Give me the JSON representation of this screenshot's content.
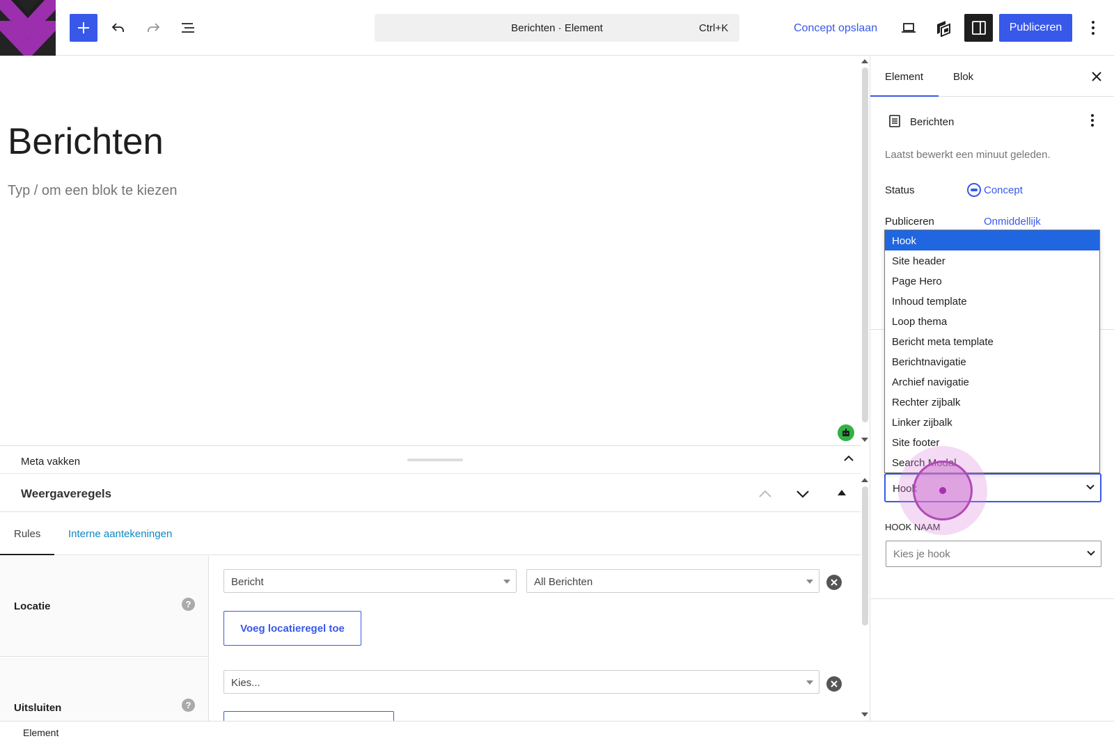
{
  "topbar": {
    "command_title": "Berichten · Element",
    "command_shortcut": "Ctrl+K",
    "save_draft_label": "Concept opslaan",
    "publish_label": "Publiceren"
  },
  "canvas": {
    "title": "Berichten",
    "placeholder": "Typ / om een blok te kiezen"
  },
  "meta_boxes": {
    "label": "Meta vakken",
    "panel_title": "Weergaveregels",
    "tabs": [
      "Rules",
      "Interne aantekeningen"
    ],
    "location": {
      "label": "Locatie",
      "help": "?",
      "rule_type": "Bericht",
      "rule_value": "All Berichten",
      "add_button": "Voeg locatieregel toe"
    },
    "exclude": {
      "label": "Uitsluiten",
      "help": "?",
      "select_value": "Kies..."
    }
  },
  "footer": {
    "breadcrumb": "Element"
  },
  "sidebar": {
    "tabs": [
      "Element",
      "Blok"
    ],
    "document_name": "Berichten",
    "last_edited": "Laatst bewerkt een minuut geleden.",
    "status_label": "Status",
    "status_value": "Concept",
    "publish_label": "Publiceren",
    "publish_value": "Onmiddellijk",
    "element_type_value": "Hook",
    "hook_name_label": "HOOK NAAM",
    "hook_name_placeholder": "Kies je hook"
  },
  "dropdown": {
    "selected_index": 0,
    "options": [
      "Hook",
      "Site header",
      "Page Hero",
      "Inhoud template",
      "Loop thema",
      "Bericht meta template",
      "Berichtnavigatie",
      "Archief navigatie",
      "Rechter zijbalk",
      "Linker zijbalk",
      "Site footer",
      "Search Modal"
    ]
  },
  "colors": {
    "accent": "#3858e9",
    "dropdown_highlight": "#1f66e0",
    "link_teal": "#0d88c1",
    "cursor_highlight": "#b04ab8"
  }
}
